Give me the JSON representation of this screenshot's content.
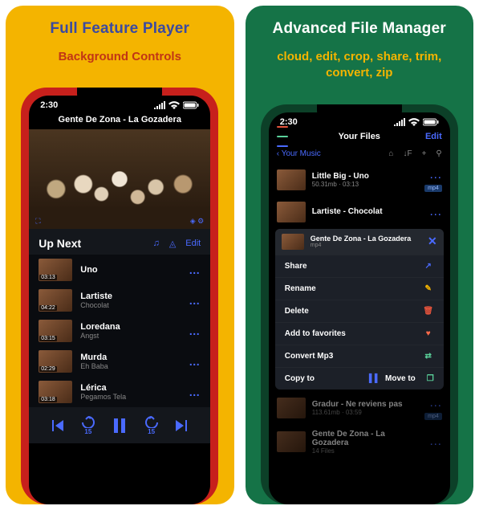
{
  "left": {
    "headline": "Full Feature Player",
    "subline": "Background Controls",
    "status_time": "2:30",
    "now_playing": "Gente De Zona - La Gozadera",
    "up_next_label": "Up Next",
    "edit_label": "Edit",
    "skip_back": "15",
    "skip_fwd": "15",
    "queue": [
      {
        "ts": "03:13",
        "t1": "Uno",
        "t2": ""
      },
      {
        "ts": "04:22",
        "t1": "Lartiste",
        "t2": "Chocolat"
      },
      {
        "ts": "03:15",
        "t1": "Loredana",
        "t2": "Angst"
      },
      {
        "ts": "02:29",
        "t1": "Murda",
        "t2": "Eh Baba"
      },
      {
        "ts": "03:18",
        "t1": "Lérica",
        "t2": "Pegamos Tela"
      }
    ]
  },
  "right": {
    "headline": "Advanced File Manager",
    "subline": "cloud, edit, crop, share, trim, convert, zip",
    "status_time": "2:30",
    "title": "Your Files",
    "edit_label": "Edit",
    "crumb": "Your Music",
    "files_top": [
      {
        "t1": "Little Big - Uno",
        "t2": "50.31mb · 03:13",
        "badge": "mp4"
      },
      {
        "t1": "Lartiste - Chocolat",
        "t2": "",
        "badge": ""
      }
    ],
    "popup": {
      "title": "Gente De Zona - La Gozadera",
      "sub": "mp4",
      "items": [
        {
          "label": "Share",
          "icon": "share",
          "color": "#4a6aff"
        },
        {
          "label": "Rename",
          "icon": "pencil",
          "color": "#f4b400"
        },
        {
          "label": "Delete",
          "icon": "trash",
          "color": "#e5533c"
        },
        {
          "label": "Add to favorites",
          "icon": "heart",
          "color": "#ff6b4a"
        },
        {
          "label": "Convert Mp3",
          "icon": "convert",
          "color": "#5ad19a"
        }
      ],
      "copy_label": "Copy to",
      "move_label": "Move to"
    },
    "files_bottom": [
      {
        "t1": "Gradur - Ne reviens pas",
        "t2": "113.61mb · 03:59",
        "badge": "mp4"
      },
      {
        "t1": "Gente De Zona - La Gozadera",
        "t2": "14 Files",
        "badge": ""
      }
    ]
  }
}
